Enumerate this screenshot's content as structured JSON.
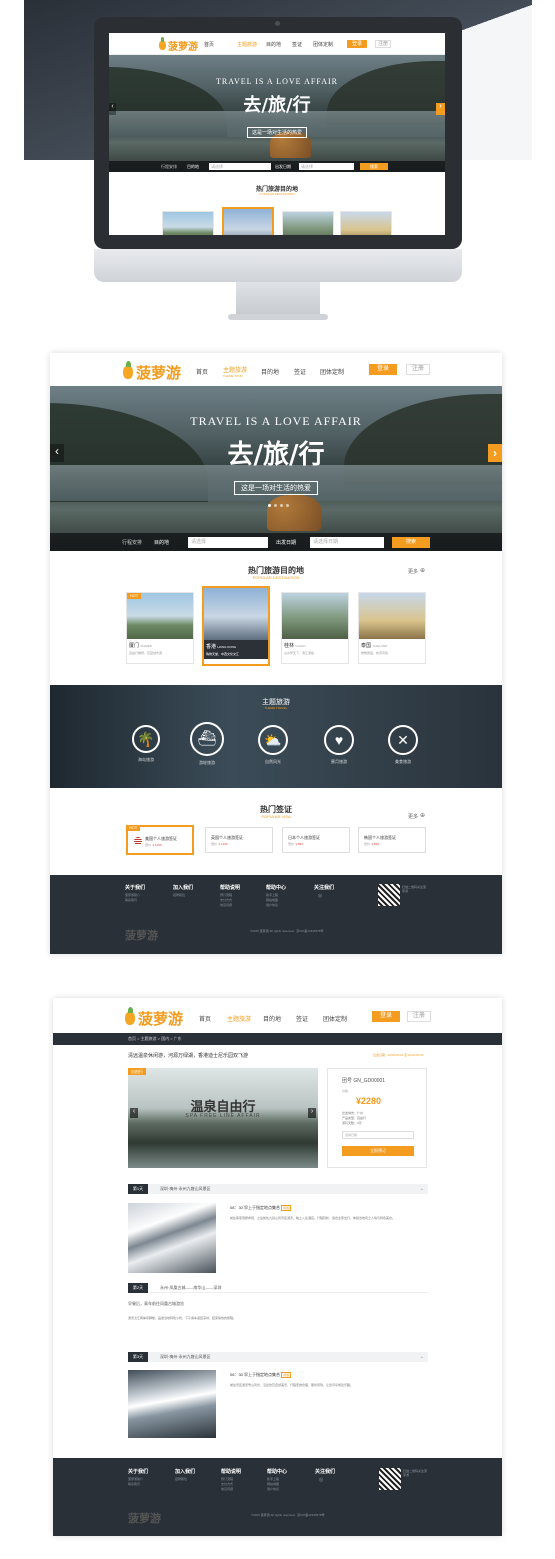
{
  "colors": {
    "accent": "#f39c1f",
    "dark": "#2a3038",
    "text": "#333333"
  },
  "logo": {
    "text": "菠萝游"
  },
  "nav": {
    "items": [
      "首页",
      "主题旅游",
      "目的地",
      "签证",
      "团体定制"
    ],
    "active_sub": "THEME TOUR",
    "login": "登录",
    "register": "注册"
  },
  "hero": {
    "en": "TRAVEL IS A LOVE AFFAIR",
    "cn": "去/旅/行",
    "sub": "这是一场对生活的热爱",
    "icon_prev": "chevron-left-icon",
    "icon_next": "chevron-right-icon"
  },
  "search": {
    "label": "行程安排",
    "dest_label": "目的地",
    "dest_ph": "请选择",
    "date_label": "出发日期",
    "date_ph": "请选择日期",
    "btn": "搜索"
  },
  "mini_search": {
    "label": "行程安排",
    "dest_label": "目的地",
    "dest_ph": "请选择",
    "date_label": "出发日期",
    "date_ph": "请选择",
    "btn": "搜索"
  },
  "hot_dest": {
    "title": "热门旅游目的地",
    "sub": "POPULAR DESTINATION",
    "more": "更多",
    "items": [
      {
        "badge": "HOT",
        "name": "厦门",
        "en": "XIAMEN",
        "desc": "自由行推荐，花园城市游"
      },
      {
        "name": "香港",
        "en": "HONG KONG",
        "desc": "购物天堂，中西文化交汇"
      },
      {
        "name": "桂林",
        "en": "GUILIN",
        "desc": "山水甲天下，漓江游船"
      },
      {
        "name": "泰国",
        "en": "THAILAND",
        "desc": "佛教国度，热带风情"
      }
    ]
  },
  "theme": {
    "title": "主题旅游",
    "sub": "THEME TRAVEL",
    "items": [
      {
        "label": "海岛旅游",
        "icon": "palm-tree-icon"
      },
      {
        "label": "游轮旅游",
        "icon": "cruise-ship-icon"
      },
      {
        "label": "自然风光",
        "icon": "sun-cloud-icon"
      },
      {
        "label": "蜜月旅游",
        "icon": "heart-icon"
      },
      {
        "label": "美食旅游",
        "icon": "fork-knife-icon"
      }
    ]
  },
  "visa": {
    "title": "热门签证",
    "sub": "POPULAR VISA",
    "more": "更多",
    "items": [
      {
        "badge": "HOT",
        "name": "美国个人旅游签证",
        "price_label": "低价",
        "price": "￥1499"
      },
      {
        "name": "英国个人旅游签证",
        "price_label": "低价",
        "price": "￥1499"
      },
      {
        "name": "日本个人旅游签证",
        "price_label": "低价",
        "price": "￥899"
      },
      {
        "name": "韩国个人旅游签证",
        "price_label": "低价",
        "price": "￥599"
      }
    ]
  },
  "footer": {
    "cols": [
      {
        "h": "关于我们",
        "i": [
          "菠萝游简介",
          "联系我们"
        ]
      },
      {
        "h": "加入我们",
        "i": [
          "招聘职位"
        ]
      },
      {
        "h": "帮助说明",
        "i": [
          "预订流程",
          "支付方式",
          "常见问题"
        ]
      },
      {
        "h": "帮助中心",
        "i": [
          "新手上路",
          "网站地图",
          "用户协议"
        ]
      },
      {
        "h": "关注我们",
        "i": [
          "微博"
        ]
      }
    ],
    "qr_caption": "扫描二维码关注菠萝游",
    "copy": "©2015 菠萝游 All rights reserved · 京ICP备12345678号"
  },
  "detail": {
    "crumb": "首页 > 主题旅游 > 国内 > 广东",
    "title": "清远温泉休闲游，河源万绿湖，香港迪士尼乐园双飞游",
    "date": "出发日期：2015-05-01 至 2015-05-30",
    "badge": "自由行",
    "banner_cn": "温泉自由行",
    "banner_en": "SPA FREE LINE AFFAIR",
    "code": "团号 GN_GD00001",
    "price_label": "价格",
    "price": "¥2280",
    "specs": [
      "出发城市：广州",
      "产品类型：自由行",
      "游玩天数：3天"
    ],
    "date_ph": "选择日期",
    "book": "立即预订",
    "days": [
      {
        "tag": "第1天",
        "route": "深圳·梅州·永州九嶷山风景区",
        "time": "08：30 早上于指定地点集合",
        "tag2": "用餐",
        "desc": "前往客家围屋参观，之后前往九嶷山风景区游览，晚上入住酒店。行程轻松，适合全家出行，体验当地风土人情与特色美食。"
      },
      {
        "tag": "第2天",
        "route": "永州·凤凰古城——南华山——深圳",
        "text": "早餐后，乘车前往凤凰古城游览",
        "desc": "游览沱江两岸吊脚楼，品尝当地特色小吃，下午乘车返回深圳，结束愉快的旅程。"
      },
      {
        "tag": "第3天",
        "route": "深圳·梅州·永州九嶷山风景区",
        "time": "08：30 早上于指定地点集合",
        "tag2": "用餐",
        "desc": "前往景区游览雪山风光，沿途欣赏自然美景，行程安排合理，服务周到，让您尽享旅途乐趣。"
      }
    ]
  }
}
